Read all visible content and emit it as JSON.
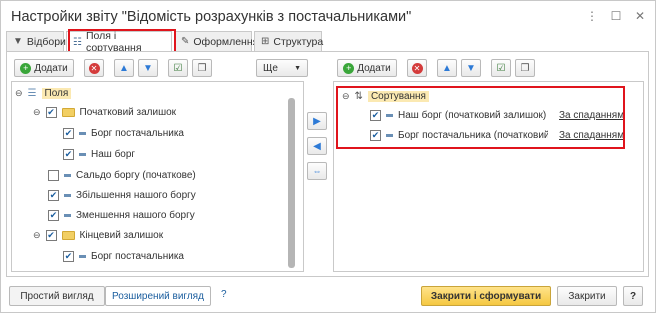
{
  "window": {
    "title": "Настройки звіту \"Відомість розрахунків з постачальниками\""
  },
  "window_buttons": [
    "⋮",
    "☐",
    "✕"
  ],
  "tabs": [
    {
      "label": "Відбори"
    },
    {
      "label": "Поля і сортування"
    },
    {
      "label": "Оформлення"
    },
    {
      "label": "Структура"
    }
  ],
  "left_toolbar": {
    "add_label": "Додати",
    "more_label": "Ще"
  },
  "right_toolbar": {
    "add_label": "Додати"
  },
  "fields_tree": {
    "root_label": "Поля",
    "items": [
      {
        "label": "Початковий залишок"
      },
      {
        "label": "Борг постачальника"
      },
      {
        "label": "Наш борг"
      },
      {
        "label": "Сальдо боргу (початкове)"
      },
      {
        "label": "Збільшення нашого боргу"
      },
      {
        "label": "Зменшення нашого боргу"
      },
      {
        "label": "Кінцевий залишок"
      },
      {
        "label": "Борг постачальника"
      }
    ]
  },
  "sort_tree": {
    "root_label": "Сортування",
    "items": [
      {
        "label": "Наш борг (початковий залишок)",
        "direction": "За спаданням"
      },
      {
        "label": "Борг постачальника (початковий з...",
        "direction": "За спаданням"
      }
    ]
  },
  "footer": {
    "simple_view": "Простий вигляд",
    "advanced_view": "Розширений вигляд",
    "help_mark": "?",
    "close_and_build": "Закрити і сформувати",
    "close": "Закрити",
    "help_button": "?"
  },
  "colors": {
    "highlight": "#e0141c",
    "primary_button": "#f5c842",
    "link": "#1a5d9e"
  }
}
